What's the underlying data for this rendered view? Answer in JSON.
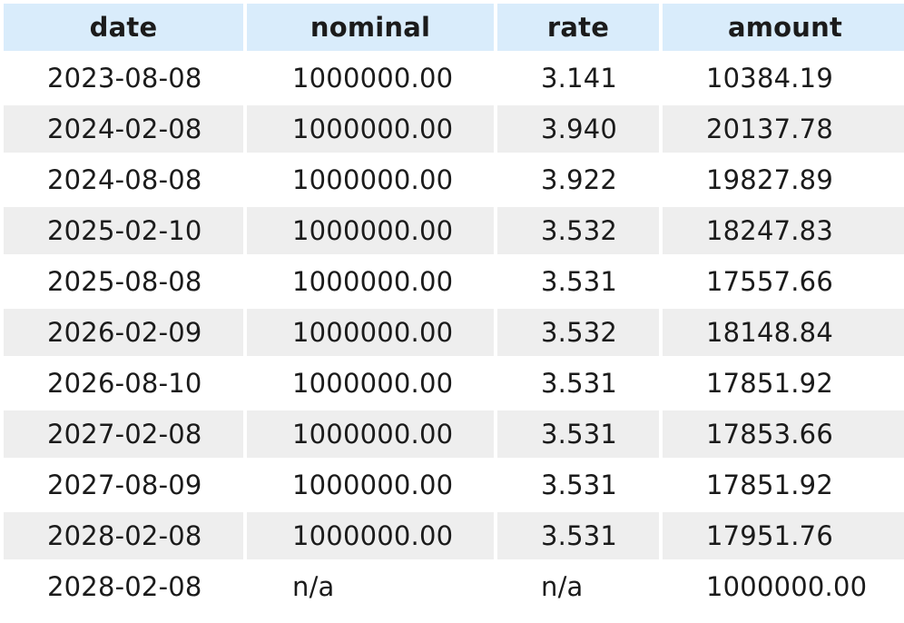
{
  "table": {
    "headers": [
      "date",
      "nominal",
      "rate",
      "amount"
    ],
    "rows": [
      [
        "2023-08-08",
        "1000000.00",
        "3.141",
        "10384.19"
      ],
      [
        "2024-02-08",
        "1000000.00",
        "3.940",
        "20137.78"
      ],
      [
        "2024-08-08",
        "1000000.00",
        "3.922",
        "19827.89"
      ],
      [
        "2025-02-10",
        "1000000.00",
        "3.532",
        "18247.83"
      ],
      [
        "2025-08-08",
        "1000000.00",
        "3.531",
        "17557.66"
      ],
      [
        "2026-02-09",
        "1000000.00",
        "3.532",
        "18148.84"
      ],
      [
        "2026-08-10",
        "1000000.00",
        "3.531",
        "17851.92"
      ],
      [
        "2027-02-08",
        "1000000.00",
        "3.531",
        "17853.66"
      ],
      [
        "2027-08-09",
        "1000000.00",
        "3.531",
        "17851.92"
      ],
      [
        "2028-02-08",
        "1000000.00",
        "3.531",
        "17951.76"
      ],
      [
        "2028-02-08",
        "n/a",
        "n/a",
        "1000000.00"
      ]
    ]
  },
  "colors": {
    "header_bg": "#d9ecfb",
    "stripe_bg": "#eeeeee",
    "text": "#1b1b1b"
  }
}
